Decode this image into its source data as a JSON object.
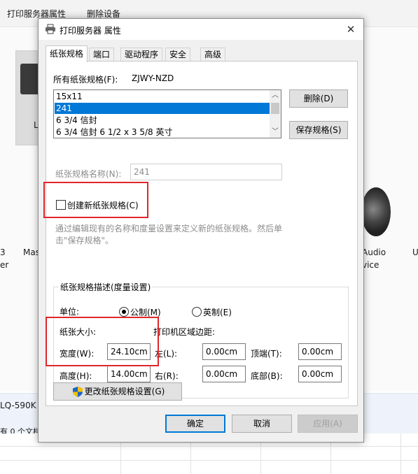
{
  "background": {
    "menu": [
      "打印服务器属性",
      "删除设备"
    ],
    "device_labels": {
      "left_l": "L",
      "left_3": "3",
      "left_er": "er",
      "mas": "Mas",
      "audio": "Audio",
      "vice": "vice",
      "u": "U",
      "printer_name": "LQ-590K",
      "queue_status": "有 0 个文档"
    }
  },
  "dialog": {
    "title": "打印服务器 属性",
    "close": "✕",
    "tabs": [
      "纸张规格",
      "端口",
      "驱动程序",
      "安全",
      "高级"
    ],
    "all_forms_label": "所有纸张规格(F):",
    "server_name": "ZJWY-NZD",
    "form_list": [
      "15x11",
      "241",
      "6 3/4 信封",
      "6 3/4 信封 6 1/2 x 3 5/8 英寸"
    ],
    "selected_form": "241",
    "delete_button": "删除(D)",
    "save_button": "保存规格(S)",
    "form_name_label": "纸张规格名称(N):",
    "form_name_value": "241",
    "create_new_label": "创建新纸张规格(C)",
    "create_new_checked": false,
    "hint_line1": "通过编辑现有的名称和度量设置来定义新的纸张规格。然后单",
    "hint_line2": "击\"保存规格\"。",
    "group_title": "纸张规格描述(度量设置)",
    "unit_label": "单位:",
    "metric_label": "公制(M)",
    "english_label": "英制(E)",
    "selected_unit": "metric",
    "paper_size_label": "纸张大小:",
    "margins_label": "打印机区域边距:",
    "width_label": "宽度(W):",
    "width_value": "24.10cm",
    "height_label": "高度(H):",
    "height_value": "14.00cm",
    "left_label": "左(L):",
    "left_value": "0.00cm",
    "right_label": "右(R):",
    "right_value": "0.00cm",
    "top_label": "顶端(T):",
    "top_value": "0.00cm",
    "bottom_label": "底部(B):",
    "bottom_value": "0.00cm",
    "change_settings_button": "更改纸张规格设置(G)",
    "ok_button": "确定",
    "cancel_button": "取消",
    "apply_button": "应用(A)"
  },
  "colors": {
    "accent": "#0078d7",
    "highlight_box": "#e0262b",
    "dialog_bg": "#f0f0f0"
  },
  "icons": [
    "printer-icon",
    "close-icon",
    "chevron-up-icon",
    "chevron-down-icon",
    "uac-shield-icon"
  ]
}
